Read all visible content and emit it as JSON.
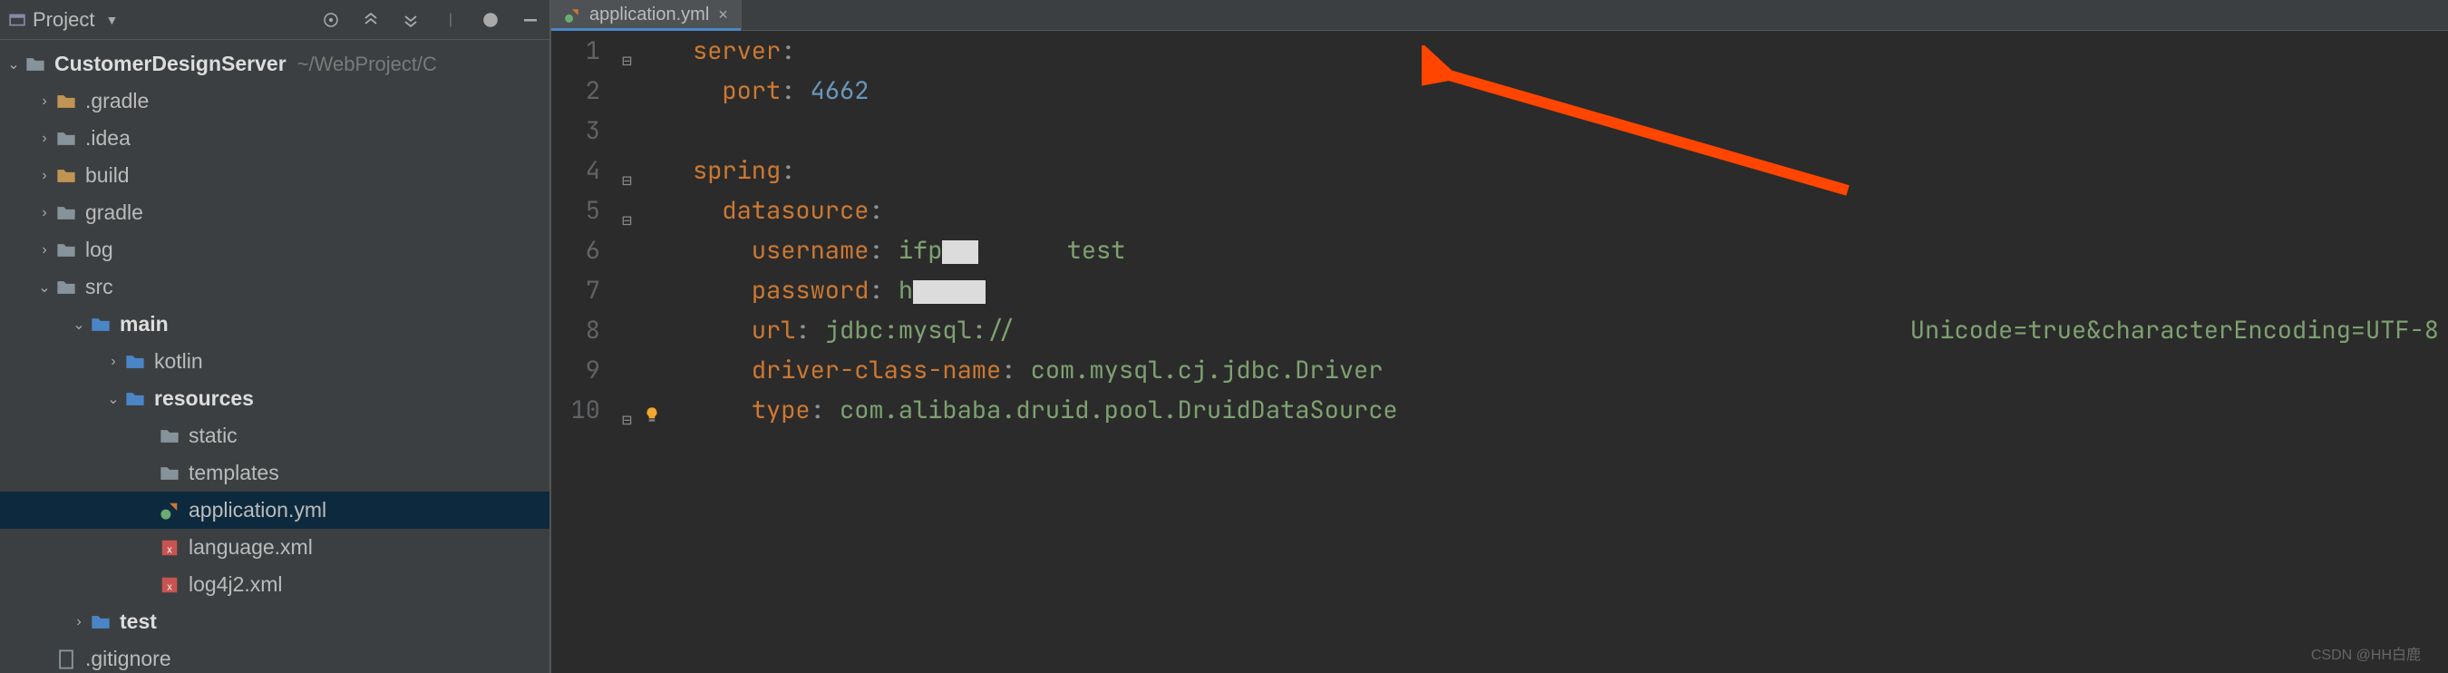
{
  "sidebar": {
    "title": "Project",
    "project_root": "CustomerDesignServer",
    "project_path": "~/WebProject/C",
    "items": [
      {
        "label": ".gradle",
        "kind": "folder-yellow",
        "expand": "closed",
        "depth": 1
      },
      {
        "label": ".idea",
        "kind": "folder-gray",
        "expand": "closed",
        "depth": 1
      },
      {
        "label": "build",
        "kind": "folder-yellow",
        "expand": "closed",
        "depth": 1
      },
      {
        "label": "gradle",
        "kind": "folder-gray",
        "expand": "closed",
        "depth": 1
      },
      {
        "label": "log",
        "kind": "folder-gray",
        "expand": "closed",
        "depth": 1
      },
      {
        "label": "src",
        "kind": "folder-gray",
        "expand": "open",
        "depth": 1
      },
      {
        "label": "main",
        "kind": "folder-blue",
        "expand": "open",
        "depth": 2,
        "bold": true
      },
      {
        "label": "kotlin",
        "kind": "folder-blue",
        "expand": "closed",
        "depth": 3
      },
      {
        "label": "resources",
        "kind": "folder-blue",
        "expand": "open",
        "depth": 3,
        "bold": true
      },
      {
        "label": "static",
        "kind": "folder-gray",
        "expand": "none",
        "depth": 4
      },
      {
        "label": "templates",
        "kind": "folder-gray",
        "expand": "none",
        "depth": 4
      },
      {
        "label": "application.yml",
        "kind": "yml",
        "expand": "none",
        "depth": 4,
        "selected": true
      },
      {
        "label": "language.xml",
        "kind": "xml",
        "expand": "none",
        "depth": 4
      },
      {
        "label": "log4j2.xml",
        "kind": "xml",
        "expand": "none",
        "depth": 4
      },
      {
        "label": "test",
        "kind": "folder-blue",
        "expand": "closed",
        "depth": 2,
        "bold": true
      },
      {
        "label": ".gitignore",
        "kind": "file",
        "expand": "none",
        "depth": 1
      }
    ]
  },
  "tab": {
    "label": "application.yml"
  },
  "code": {
    "lines": [
      {
        "n": "1",
        "segs": [
          {
            "t": "server",
            "c": "k-key"
          },
          {
            "t": ":",
            "c": "k-val"
          }
        ],
        "indent": 0
      },
      {
        "n": "2",
        "segs": [
          {
            "t": "port",
            "c": "k-key"
          },
          {
            "t": ": ",
            "c": "k-val"
          },
          {
            "t": "4662",
            "c": "k-num"
          }
        ],
        "indent": 1
      },
      {
        "n": "3",
        "segs": [],
        "indent": 0
      },
      {
        "n": "4",
        "segs": [
          {
            "t": "spring",
            "c": "k-key"
          },
          {
            "t": ":",
            "c": "k-val"
          }
        ],
        "indent": 0
      },
      {
        "n": "5",
        "segs": [
          {
            "t": "datasource",
            "c": "k-key"
          },
          {
            "t": ":",
            "c": "k-val"
          }
        ],
        "indent": 1
      },
      {
        "n": "6",
        "segs": [
          {
            "t": "username",
            "c": "k-key"
          },
          {
            "t": ": ",
            "c": "k-val"
          },
          {
            "t": "ifp",
            "c": "k-str"
          },
          {
            "redact": 40
          },
          {
            "t": "      test",
            "c": "k-str"
          }
        ],
        "indent": 2
      },
      {
        "n": "7",
        "segs": [
          {
            "t": "password",
            "c": "k-key"
          },
          {
            "t": ": ",
            "c": "k-val"
          },
          {
            "t": "h",
            "c": "k-str"
          },
          {
            "redact": 80
          }
        ],
        "indent": 2
      },
      {
        "n": "8",
        "segs": [
          {
            "t": "url",
            "c": "k-key"
          },
          {
            "t": ": ",
            "c": "k-val"
          },
          {
            "t": "jdbc:mysql://",
            "c": "k-str"
          }
        ],
        "indent": 2,
        "trail": "Unicode=true&characterEncoding=UTF-8"
      },
      {
        "n": "9",
        "segs": [
          {
            "t": "driver-class-name",
            "c": "k-key"
          },
          {
            "t": ": ",
            "c": "k-val"
          },
          {
            "t": "com.mysql.cj.jdbc.Driver",
            "c": "k-str"
          }
        ],
        "indent": 2
      },
      {
        "n": "10",
        "segs": [
          {
            "t": "type",
            "c": "k-key"
          },
          {
            "t": ": ",
            "c": "k-val"
          },
          {
            "t": "com.alibaba.druid.pool.DruidDataSource",
            "c": "k-str"
          }
        ],
        "indent": 2
      }
    ]
  },
  "watermark": "CSDN @HH白鹿"
}
